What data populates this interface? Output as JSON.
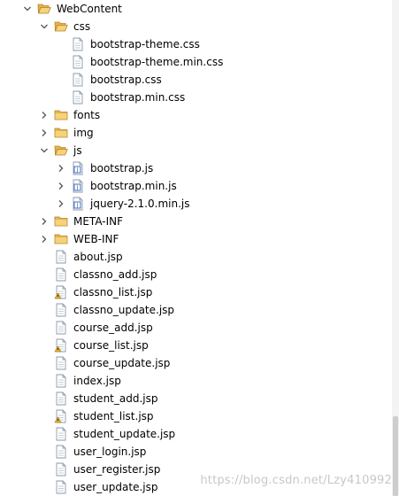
{
  "tree": [
    {
      "label": "WebContent",
      "depth": 0,
      "kind": "folder-open",
      "toggle": "expanded"
    },
    {
      "label": "css",
      "depth": 1,
      "kind": "folder-open",
      "toggle": "expanded"
    },
    {
      "label": "bootstrap-theme.css",
      "depth": 2,
      "kind": "file",
      "toggle": "none"
    },
    {
      "label": "bootstrap-theme.min.css",
      "depth": 2,
      "kind": "file",
      "toggle": "none"
    },
    {
      "label": "bootstrap.css",
      "depth": 2,
      "kind": "file",
      "toggle": "none"
    },
    {
      "label": "bootstrap.min.css",
      "depth": 2,
      "kind": "file",
      "toggle": "none"
    },
    {
      "label": "fonts",
      "depth": 1,
      "kind": "folder",
      "toggle": "collapsed"
    },
    {
      "label": "img",
      "depth": 1,
      "kind": "folder",
      "toggle": "collapsed"
    },
    {
      "label": "js",
      "depth": 1,
      "kind": "folder-open",
      "toggle": "expanded"
    },
    {
      "label": "bootstrap.js",
      "depth": 2,
      "kind": "js-file",
      "toggle": "collapsed"
    },
    {
      "label": "bootstrap.min.js",
      "depth": 2,
      "kind": "js-file",
      "toggle": "collapsed"
    },
    {
      "label": "jquery-2.1.0.min.js",
      "depth": 2,
      "kind": "js-file",
      "toggle": "collapsed"
    },
    {
      "label": "META-INF",
      "depth": 1,
      "kind": "folder",
      "toggle": "collapsed"
    },
    {
      "label": "WEB-INF",
      "depth": 1,
      "kind": "folder",
      "toggle": "collapsed"
    },
    {
      "label": "about.jsp",
      "depth": 1,
      "kind": "file",
      "toggle": "none"
    },
    {
      "label": "classno_add.jsp",
      "depth": 1,
      "kind": "file",
      "toggle": "none"
    },
    {
      "label": "classno_list.jsp",
      "depth": 1,
      "kind": "file-warning",
      "toggle": "none"
    },
    {
      "label": "classno_update.jsp",
      "depth": 1,
      "kind": "file",
      "toggle": "none"
    },
    {
      "label": "course_add.jsp",
      "depth": 1,
      "kind": "file",
      "toggle": "none"
    },
    {
      "label": "course_list.jsp",
      "depth": 1,
      "kind": "file-warning",
      "toggle": "none"
    },
    {
      "label": "course_update.jsp",
      "depth": 1,
      "kind": "file",
      "toggle": "none"
    },
    {
      "label": "index.jsp",
      "depth": 1,
      "kind": "file",
      "toggle": "none"
    },
    {
      "label": "student_add.jsp",
      "depth": 1,
      "kind": "file",
      "toggle": "none"
    },
    {
      "label": "student_list.jsp",
      "depth": 1,
      "kind": "file-warning",
      "toggle": "none"
    },
    {
      "label": "student_update.jsp",
      "depth": 1,
      "kind": "file",
      "toggle": "none"
    },
    {
      "label": "user_login.jsp",
      "depth": 1,
      "kind": "file",
      "toggle": "none"
    },
    {
      "label": "user_register.jsp",
      "depth": 1,
      "kind": "file",
      "toggle": "none"
    },
    {
      "label": "user_update.jsp",
      "depth": 1,
      "kind": "file",
      "toggle": "none"
    }
  ],
  "watermark": "https://blog.csdn.net/Lzy410992",
  "colors": {
    "folder": "#e8b44a",
    "folder_edge": "#b4822a",
    "file_edge": "#8a9aac",
    "js_badge": "#2f62b8",
    "warning": "#e3b12a",
    "toggle": "#555555"
  }
}
